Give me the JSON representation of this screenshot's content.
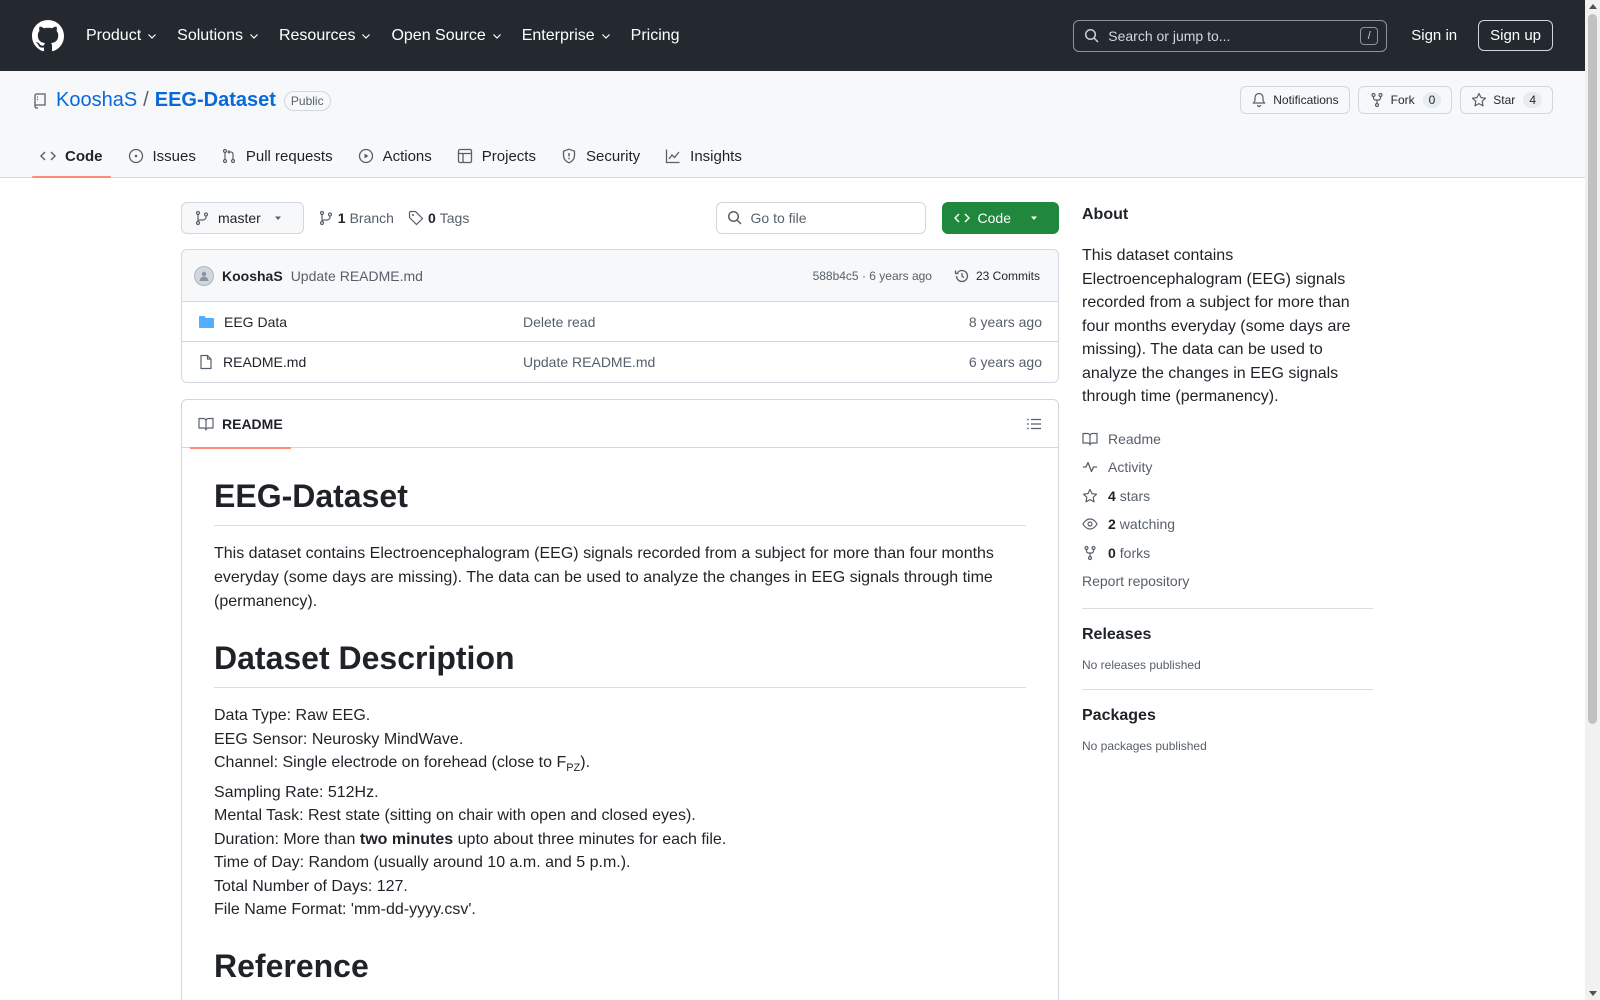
{
  "header": {
    "nav": [
      {
        "label": "Product",
        "dropdown": true
      },
      {
        "label": "Solutions",
        "dropdown": true
      },
      {
        "label": "Resources",
        "dropdown": true
      },
      {
        "label": "Open Source",
        "dropdown": true
      },
      {
        "label": "Enterprise",
        "dropdown": true
      },
      {
        "label": "Pricing",
        "dropdown": false
      }
    ],
    "search_placeholder": "Search or jump to...",
    "search_shortcut": "/",
    "signin": "Sign in",
    "signup": "Sign up"
  },
  "repo": {
    "owner": "KooshaS",
    "separator": "/",
    "name": "EEG-Dataset",
    "visibility": "Public",
    "notifications": "Notifications",
    "fork_label": "Fork",
    "fork_count": "0",
    "star_label": "Star",
    "star_count": "4"
  },
  "tabs": [
    {
      "label": "Code",
      "icon": "code-icon",
      "active": true
    },
    {
      "label": "Issues",
      "icon": "issue-icon"
    },
    {
      "label": "Pull requests",
      "icon": "pull-request-icon"
    },
    {
      "label": "Actions",
      "icon": "play-icon"
    },
    {
      "label": "Projects",
      "icon": "table-icon"
    },
    {
      "label": "Security",
      "icon": "shield-icon"
    },
    {
      "label": "Insights",
      "icon": "graph-icon"
    }
  ],
  "toolbar": {
    "branch": "master",
    "branch_count": "1",
    "branch_label": "Branch",
    "tag_count": "0",
    "tag_label": "Tags",
    "goto_file": "Go to file",
    "code_button": "Code"
  },
  "commit": {
    "author": "KooshaS",
    "message": "Update README.md",
    "meta": "588b4c5 · 6 years ago",
    "commits": "23 Commits"
  },
  "files": [
    {
      "name": "EEG Data",
      "type": "folder",
      "message": "Delete read",
      "time": "8 years ago"
    },
    {
      "name": "README.md",
      "type": "file",
      "message": "Update README.md",
      "time": "6 years ago"
    }
  ],
  "readme": {
    "tab": "README",
    "title": "EEG-Dataset",
    "intro": "This dataset contains Electroencephalogram (EEG) signals recorded from a subject for more than four months everyday (some days are missing). The data can be used to analyze the changes in EEG signals through time (permanency).",
    "desc_heading": "Dataset Description",
    "lines": {
      "data_type": "Data Type: Raw EEG.",
      "sensor": "EEG Sensor: Neurosky MindWave.",
      "channel_pre": "Channel: Single electrode on forehead (close to F",
      "channel_sub": "PZ",
      "channel_post": ").",
      "sampling": "Sampling Rate: 512Hz.",
      "task": "Mental Task: Rest state (sitting on chair with open and closed eyes).",
      "duration_pre": "Duration: More than ",
      "duration_bold": "two minutes",
      "duration_post": " upto about three minutes for each file.",
      "time_of_day": "Time of Day: Random (usually around 10 a.m. and 5 p.m.).",
      "days": "Total Number of Days: 127.",
      "format": "File Name Format: 'mm-dd-yyyy.csv'."
    },
    "ref_heading": "Reference"
  },
  "sidebar": {
    "about_title": "About",
    "about_text": "This dataset contains Electroencephalogram (EEG) signals recorded from a subject for more than four months everyday (some days are missing). The data can be used to analyze the changes in EEG signals through time (permanency).",
    "readme": "Readme",
    "activity": "Activity",
    "stars_count": "4",
    "stars_label": "stars",
    "watching_count": "2",
    "watching_label": "watching",
    "forks_count": "0",
    "forks_label": "forks",
    "report": "Report repository",
    "releases_title": "Releases",
    "releases_text": "No releases published",
    "packages_title": "Packages",
    "packages_text": "No packages published"
  },
  "colors": {
    "header_bg": "#24292f",
    "link": "#0969da",
    "green": "#1f883d",
    "tab_underline": "#fd8c73",
    "folder": "#54aeff"
  }
}
